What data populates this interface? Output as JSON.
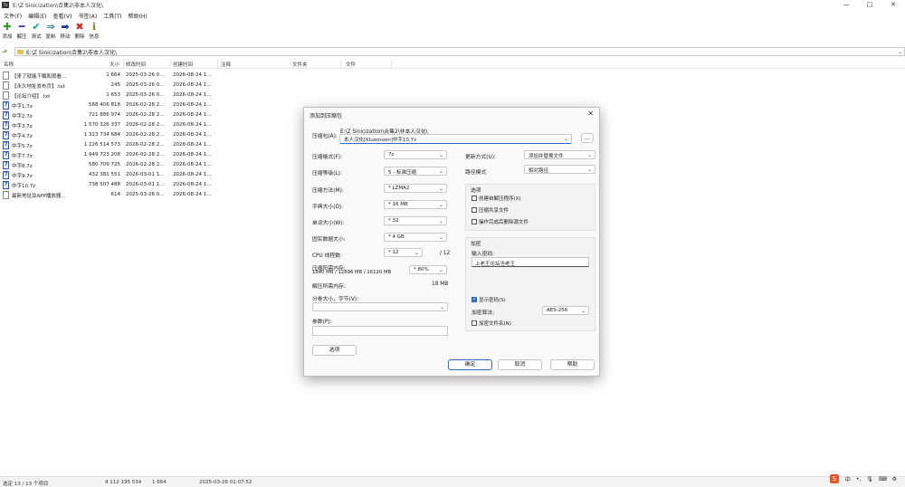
{
  "window": {
    "title": "E:\\Z Sinicization\\合集2\\非本人汉化\\",
    "app_icon": "7zip-icon",
    "controls": [
      "—",
      "□",
      "✕"
    ]
  },
  "menu": [
    "文件(F)",
    "编辑(E)",
    "查看(V)",
    "书签(A)",
    "工具(T)",
    "帮助(H)"
  ],
  "toolbar": [
    {
      "label": "添加",
      "icon": "add-icon",
      "glyph": "✚",
      "color": "#2f9e20"
    },
    {
      "label": "解压",
      "icon": "extract-icon",
      "glyph": "━",
      "color": "#2a3f9e"
    },
    {
      "label": "测试",
      "icon": "test-icon",
      "glyph": "✔",
      "color": "#1a9aa8"
    },
    {
      "label": "复制",
      "icon": "copy-icon",
      "glyph": "⇒",
      "color": "#1a8a9a"
    },
    {
      "label": "移动",
      "icon": "move-icon",
      "glyph": "➡",
      "color": "#1a3a9a"
    },
    {
      "label": "删除",
      "icon": "delete-icon",
      "glyph": "✖",
      "color": "#d22222"
    },
    {
      "label": "信息",
      "icon": "info-icon",
      "glyph": "ℹ",
      "color": "#8a7a10"
    }
  ],
  "address": {
    "path": "E:\\Z Sinicization\\合集2\\非本人汉化\\"
  },
  "columns": {
    "name": "名称",
    "size": "大小",
    "modified": "修改时间",
    "created": "创建时间",
    "comment": "注释",
    "folders": "文件夹",
    "files": "文件"
  },
  "files": [
    {
      "name": "【来了就能下载和观看...",
      "size": "1 664",
      "modified": "2025-03-26 0...",
      "created": "2026-08-24 1...",
      "type": "txt"
    },
    {
      "name": "【永久地址发布页】.txt",
      "size": "245",
      "modified": "2025-03-26 0...",
      "created": "2026-08-24 1...",
      "type": "txt"
    },
    {
      "name": "【论坛介绍】.txt",
      "size": "1 653",
      "modified": "2025-03-26 0...",
      "created": "2026-08-24 1...",
      "type": "txt"
    },
    {
      "name": "中字1.7z",
      "size": "568 406 818",
      "modified": "2026-02-28 2...",
      "created": "2026-08-24 1...",
      "type": "7z"
    },
    {
      "name": "中字2.7z",
      "size": "721 886 974",
      "modified": "2026-02-28 2...",
      "created": "2026-08-24 1...",
      "type": "7z"
    },
    {
      "name": "中字3.7z",
      "size": "1 570 326 337",
      "modified": "2026-02-28 2...",
      "created": "2026-08-24 1...",
      "type": "7z"
    },
    {
      "name": "中字4.7z",
      "size": "1 323 734 684",
      "modified": "2026-02-28 2...",
      "created": "2026-08-24 1...",
      "type": "7z"
    },
    {
      "name": "中字5.7z",
      "size": "1 226 514 573",
      "modified": "2026-02-28 2...",
      "created": "2026-08-24 1...",
      "type": "7z"
    },
    {
      "name": "中字7.7z",
      "size": "1 949 723 208",
      "modified": "2026-02-28 2...",
      "created": "2026-08-24 1...",
      "type": "7z"
    },
    {
      "name": "中字8.7z",
      "size": "580 709 725",
      "modified": "2026-02-28 2...",
      "created": "2026-08-24 1...",
      "type": "7z"
    },
    {
      "name": "中字9.7z",
      "size": "432 381 551",
      "modified": "2026-03-01 1...",
      "created": "2026-08-24 1...",
      "type": "7z"
    },
    {
      "name": "中字10.7z",
      "size": "738 507 488",
      "modified": "2026-03-01 1...",
      "created": "2026-08-24 1...",
      "type": "7z"
    },
    {
      "name": "最新地址及APP播放器...",
      "size": "614",
      "modified": "2025-03-26 0...",
      "created": "2026-08-24 1...",
      "type": "txt"
    }
  ],
  "status": {
    "selection": "选定 13 / 13 个项目",
    "total": "9 112 195 534",
    "sel_size": "1 664",
    "time": "2025-03-26 01:07:52"
  },
  "tray": {
    "ime": "S",
    "items": [
      "中",
      "•,",
      "🎙",
      "⌨",
      "⚙"
    ]
  },
  "dialog": {
    "title": "添加到压缩包",
    "archive_label": "压缩包(A):",
    "archive_dir": "E:\\Z Sinicization\\合集2\\非本人汉化\\",
    "archive_name": "本人汉化[Kluemoon]中字10.7z",
    "browse": "...",
    "format_label": "压缩格式(F):",
    "format": "7z",
    "level_label": "压缩等级(L):",
    "level": "5 - 标准压缩",
    "method_label": "压缩方法(M):",
    "method": "* LZMA2",
    "dict_label": "字典大小(D):",
    "dict": "* 16 MB",
    "word_label": "单词大小(W):",
    "word": "* 32",
    "solid_label": "固实数据大小:",
    "solid": "* 4 GB",
    "cpu_label": "CPU 线程数:",
    "cpu": "* 12",
    "cpu_total": "/ 12",
    "mem_label": "压缩所需内存:",
    "mem_detail": "1840 MB / 12896 MB / 16120 MB",
    "mem_pct": "* 80%",
    "decomp_label": "解压所需内存:",
    "decomp": "18 MB",
    "split_label": "分卷大小，字节(V):",
    "split": "",
    "params_label": "参数(P):",
    "params": "",
    "options_btn": "选项",
    "update_label": "更新方式(U):",
    "update": "添加并替换文件",
    "path_label": "路径模式",
    "path": "相对路径",
    "options_group": "选项",
    "opt_sfx": "创建自解压程序(X)",
    "opt_shared": "压缩共享文件",
    "opt_delete": "操作完成后删除源文件",
    "enc_group": "加密",
    "pwd_label": "输入密码:",
    "pwd": "上老王论坛当老王",
    "show_pwd": "显示密码(S)",
    "enc_method_label": "加密算法:",
    "enc_method": "AES-256",
    "enc_names": "加密文件名(N)",
    "ok": "确定",
    "cancel": "取消",
    "help": "帮助"
  }
}
